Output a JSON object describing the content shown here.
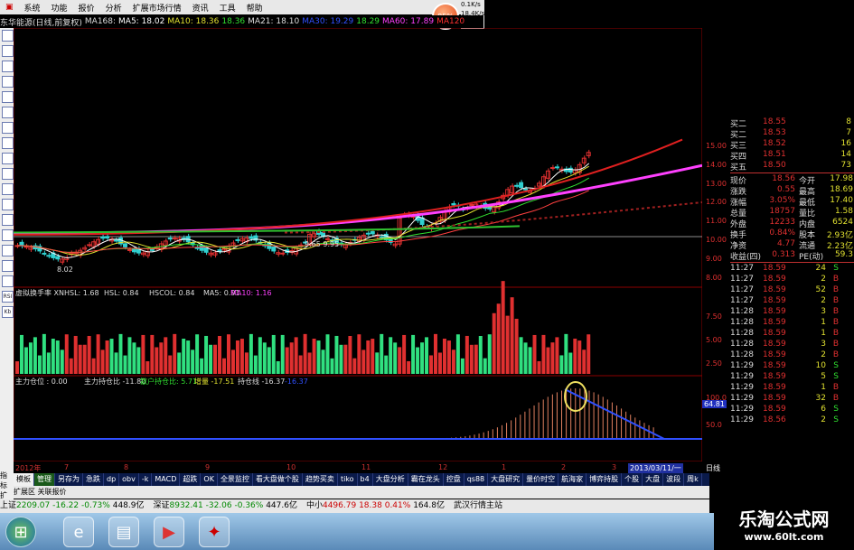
{
  "menu": {
    "items": [
      "系统",
      "功能",
      "报价",
      "分析",
      "扩展市场行情",
      "资讯",
      "工具",
      "帮助"
    ],
    "orb_text": "85%",
    "speed": [
      "0.1K/s",
      "18.4K/s"
    ]
  },
  "info": {
    "name": "东华能源(日线,前复权)",
    "ma168": "MA168:",
    "ma5": "MA5: 18.02",
    "ma10": "MA10: 18.36",
    "v1": "18.36",
    "ma21": "MA21: 18.10",
    "ma30": "MA30: 19.29",
    "v2": "18.29",
    "ma60": "MA60: 17.89",
    "ma120": "MA120"
  },
  "left_toolbar": [
    "",
    "",
    "",
    "",
    "",
    "",
    "",
    "",
    "",
    "",
    "",
    "",
    "",
    "",
    "",
    "",
    "",
    "RSI",
    "Kb"
  ],
  "chart_labels": {
    "low": "8.02",
    "mid": "9.65  9.95",
    "vol_title": "虚拟换手率 XNHSL: 1.68",
    "hsl": "HSL: 0.84",
    "hscol": "HSCOL: 0.84",
    "vma5": "MA5: 0.91",
    "vma10": "MA10: 1.16",
    "ind_a": "主力仓位 : 0.00",
    "ind_b": "主力持仓比 -11.80",
    "ind_c": "散户持仓比: 5.71",
    "ind_d": "增量 -17.51",
    "ind_e": "持仓线 -16.37",
    "ind_f": "-16.37",
    "ind_val": "64.81"
  },
  "price_scale": [
    "15.00",
    "14.00",
    "13.00",
    "12.00",
    "11.00",
    "10.00",
    "9.00",
    "8.00"
  ],
  "vol_scale": [
    "7.50",
    "5.00",
    "2.50"
  ],
  "ind_scale": [
    "100.0",
    "50.0"
  ],
  "left_axis": [
    "30",
    "25",
    "20",
    "15",
    "10",
    "5"
  ],
  "left_vol_axis": [
    "15",
    "10",
    "5"
  ],
  "order_book": [
    {
      "label": "买二",
      "price": "18.55",
      "vol": "8"
    },
    {
      "label": "买二",
      "price": "18.53",
      "vol": "7"
    },
    {
      "label": "买三",
      "price": "18.52",
      "vol": "16"
    },
    {
      "label": "买四",
      "price": "18.51",
      "vol": "14"
    },
    {
      "label": "买五",
      "price": "18.50",
      "vol": "73"
    }
  ],
  "quote": [
    {
      "k1": "现价",
      "v1": "18.56",
      "k2": "今开",
      "v2": "17.98"
    },
    {
      "k1": "涨跌",
      "v1": "0.55",
      "k2": "最高",
      "v2": "18.69"
    },
    {
      "k1": "涨幅",
      "v1": "3.05%",
      "k2": "最低",
      "v2": "17.40"
    },
    {
      "k1": "总量",
      "v1": "18757",
      "k2": "量比",
      "v2": "1.58"
    },
    {
      "k1": "外盘",
      "v1": "12233",
      "k2": "内盘",
      "v2": "6524"
    },
    {
      "k1": "换手",
      "v1": "0.84%",
      "k2": "股本",
      "v2": "2.93亿"
    },
    {
      "k1": "净资",
      "v1": "4.77",
      "k2": "流通",
      "v2": "2.23亿"
    },
    {
      "k1": "收益(四)",
      "v1": "0.313",
      "k2": "PE(动)",
      "v2": "59.3"
    }
  ],
  "ticks": [
    {
      "t": "11:27",
      "p": "18.59",
      "v": "24",
      "s": "S"
    },
    {
      "t": "11:27",
      "p": "18.59",
      "v": "2",
      "s": "B"
    },
    {
      "t": "11:27",
      "p": "18.59",
      "v": "52",
      "s": "B"
    },
    {
      "t": "11:27",
      "p": "18.59",
      "v": "2",
      "s": "B"
    },
    {
      "t": "11:28",
      "p": "18.59",
      "v": "3",
      "s": "B"
    },
    {
      "t": "11:28",
      "p": "18.59",
      "v": "1",
      "s": "B"
    },
    {
      "t": "11:28",
      "p": "18.59",
      "v": "1",
      "s": "B"
    },
    {
      "t": "11:28",
      "p": "18.59",
      "v": "3",
      "s": "B"
    },
    {
      "t": "11:28",
      "p": "18.59",
      "v": "2",
      "s": "B"
    },
    {
      "t": "11:29",
      "p": "18.59",
      "v": "10",
      "s": "S"
    },
    {
      "t": "11:29",
      "p": "18.59",
      "v": "5",
      "s": "S"
    },
    {
      "t": "11:29",
      "p": "18.59",
      "v": "1",
      "s": "B"
    },
    {
      "t": "11:29",
      "p": "18.59",
      "v": "32",
      "s": "B"
    },
    {
      "t": "11:29",
      "p": "18.59",
      "v": "6",
      "s": "S"
    },
    {
      "t": "11:29",
      "p": "18.56",
      "v": "2",
      "s": "S"
    }
  ],
  "date_axis": [
    "2012年",
    "7",
    "8",
    "9",
    "10",
    "11",
    "12",
    "1",
    "2",
    "3"
  ],
  "date_cursor": "2013/03/11/一",
  "period_label": "日线",
  "side_label": [
    "指标",
    "扩展区"
  ],
  "tabs": [
    "模板",
    "管理",
    "另存为",
    "急跌",
    "dp",
    "obv",
    "-k",
    "MACD",
    "超跌",
    "OK",
    "全景监控",
    "看大盘做个股",
    "趋势买卖",
    "tiko",
    "b4",
    "大盘分析",
    "霸在龙头",
    "控盘",
    "qs88",
    "大盘研究",
    "量价时空",
    "航海家",
    "博弈持股",
    "个股",
    "大盘",
    "波段",
    "周k"
  ],
  "subtabs": "扩展区 关联报价",
  "ticker": [
    {
      "n": "上证",
      "v": "2209.07",
      "c": "-16.22",
      "p": "-0.73%",
      "a": "448.9亿"
    },
    {
      "n": "深证",
      "v": "8932.41",
      "c": "-32.06",
      "p": "-0.36%",
      "a": "447.6亿"
    },
    {
      "n": "中小",
      "v": "4496.79",
      "c": "18.38",
      "p": "0.41%",
      "a": "164.8亿"
    }
  ],
  "ticker_extra": "武汉行情主站",
  "watermark": {
    "title": "乐淘公式网",
    "url": "www.60lt.com"
  },
  "colors": {
    "up": "#e03030",
    "down": "#30d0d0",
    "ma5": "#ffffff",
    "ma10": "#e0e030",
    "ma21": "#30e030",
    "ma60": "#ff40ff",
    "ma120": "#ff3030"
  }
}
